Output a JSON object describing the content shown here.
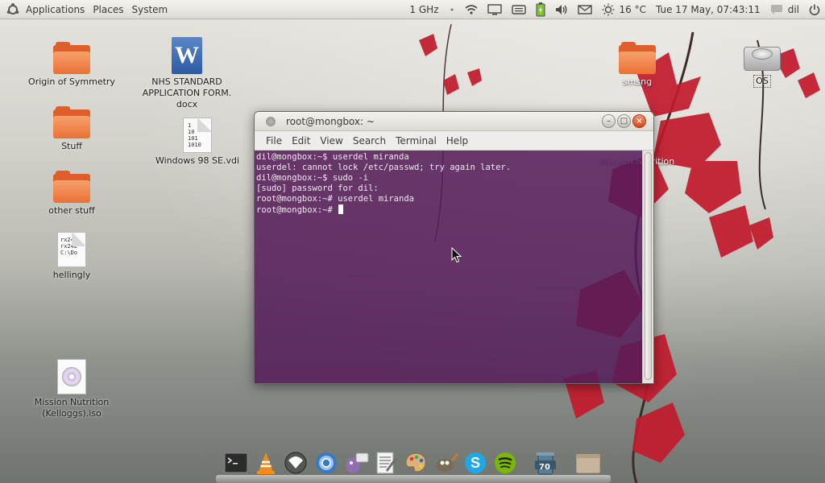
{
  "top_panel": {
    "menus": [
      "Applications",
      "Places",
      "System"
    ],
    "cpu_freq": "1 GHz",
    "temperature": "16 °C",
    "clock": "Tue 17 May, 07:43:11",
    "user": "dil",
    "icons": [
      "ubuntu-logo-icon",
      "network-wifi-icon",
      "display-icon",
      "keyboard-icon",
      "battery-icon",
      "volume-icon",
      "mail-icon",
      "weather-icon",
      "chat-icon",
      "power-icon"
    ]
  },
  "desktop": {
    "icons": [
      {
        "label": "Origin of Symmetry",
        "kind": "folder"
      },
      {
        "label": "Stuff",
        "kind": "folder"
      },
      {
        "label": "other stuff",
        "kind": "folder"
      },
      {
        "label": "hellingly",
        "kind": "text",
        "preview": [
          "rx241",
          "rx242",
          "C:\\Do"
        ]
      },
      {
        "label": "Mission Nutrition (Kelloggs).iso",
        "kind": "iso"
      },
      {
        "label": "NHS STANDARD APPLICATION FORM. docx",
        "kind": "word",
        "glyph": "W"
      },
      {
        "label": "Windows 98 SE.vdi",
        "kind": "binary",
        "preview": [
          "1",
          "10",
          "101",
          "1010"
        ]
      },
      {
        "label": "smsng",
        "kind": "folder"
      },
      {
        "label": "OS",
        "kind": "drive"
      },
      {
        "label": "Mission Nutrition",
        "kind": "label"
      }
    ]
  },
  "terminal": {
    "title": "root@mongbox: ~",
    "menus": [
      "File",
      "Edit",
      "View",
      "Search",
      "Terminal",
      "Help"
    ],
    "window_buttons": {
      "minimize": "–",
      "maximize": "□",
      "close": "×"
    },
    "lines": [
      "dil@mongbox:~$ userdel miranda",
      "userdel: cannot lock /etc/passwd; try again later.",
      "dil@mongbox:~$ sudo -i",
      "[sudo] password for dil:",
      "root@mongbox:~# userdel miranda",
      "root@mongbox:~# "
    ],
    "bg_color": "#541c59"
  },
  "dock": {
    "items": [
      {
        "name": "terminal-icon",
        "color": "#2b2b2b"
      },
      {
        "name": "vlc-icon",
        "color": "#f28c13"
      },
      {
        "name": "inkscape-icon",
        "color": "#555555"
      },
      {
        "name": "chromium-icon",
        "color": "#3b78c4"
      },
      {
        "name": "pidgin-icon",
        "color": "#8f6fb0"
      },
      {
        "name": "text-editor-icon",
        "color": "#dcdcdc"
      },
      {
        "name": "paint-icon",
        "color": "#d46a2a"
      },
      {
        "name": "gimp-icon",
        "color": "#7a6b55"
      },
      {
        "name": "skype-icon",
        "color": "#1ea8e6"
      },
      {
        "name": "spotify-icon",
        "color": "#7ab800"
      },
      {
        "name": "trash-icon",
        "color": "#5b7e96",
        "badge": "70"
      },
      {
        "name": "folder-icon",
        "color": "#c8a98a"
      }
    ]
  }
}
